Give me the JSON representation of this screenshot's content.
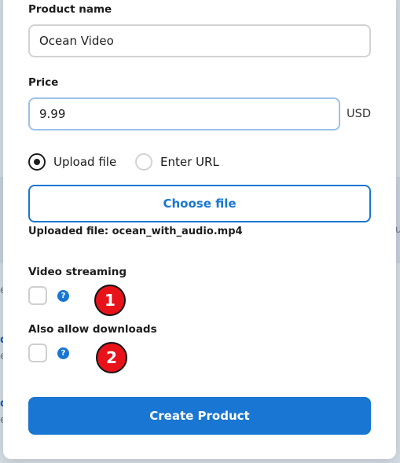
{
  "background": {
    "fragments": [
      "e",
      "d",
      "e",
      "d",
      "e",
      "u"
    ]
  },
  "form": {
    "product_name_label": "Product name",
    "product_name_value": "Ocean Video",
    "price_label": "Price",
    "price_value": "9.99",
    "currency": "USD",
    "source_options": [
      {
        "label": "Upload file",
        "checked": true
      },
      {
        "label": "Enter URL",
        "checked": false
      }
    ],
    "choose_file_label": "Choose file",
    "uploaded_file_text": "Uploaded file: ocean_with_audio.mp4",
    "video_streaming_label": "Video streaming",
    "video_streaming_checked": false,
    "allow_downloads_label": "Also allow downloads",
    "allow_downloads_checked": false,
    "help_glyph": "?",
    "create_button_label": "Create Product"
  },
  "markers": [
    "1",
    "2"
  ],
  "colors": {
    "accent": "#1976d2",
    "marker": "#e8131a"
  }
}
